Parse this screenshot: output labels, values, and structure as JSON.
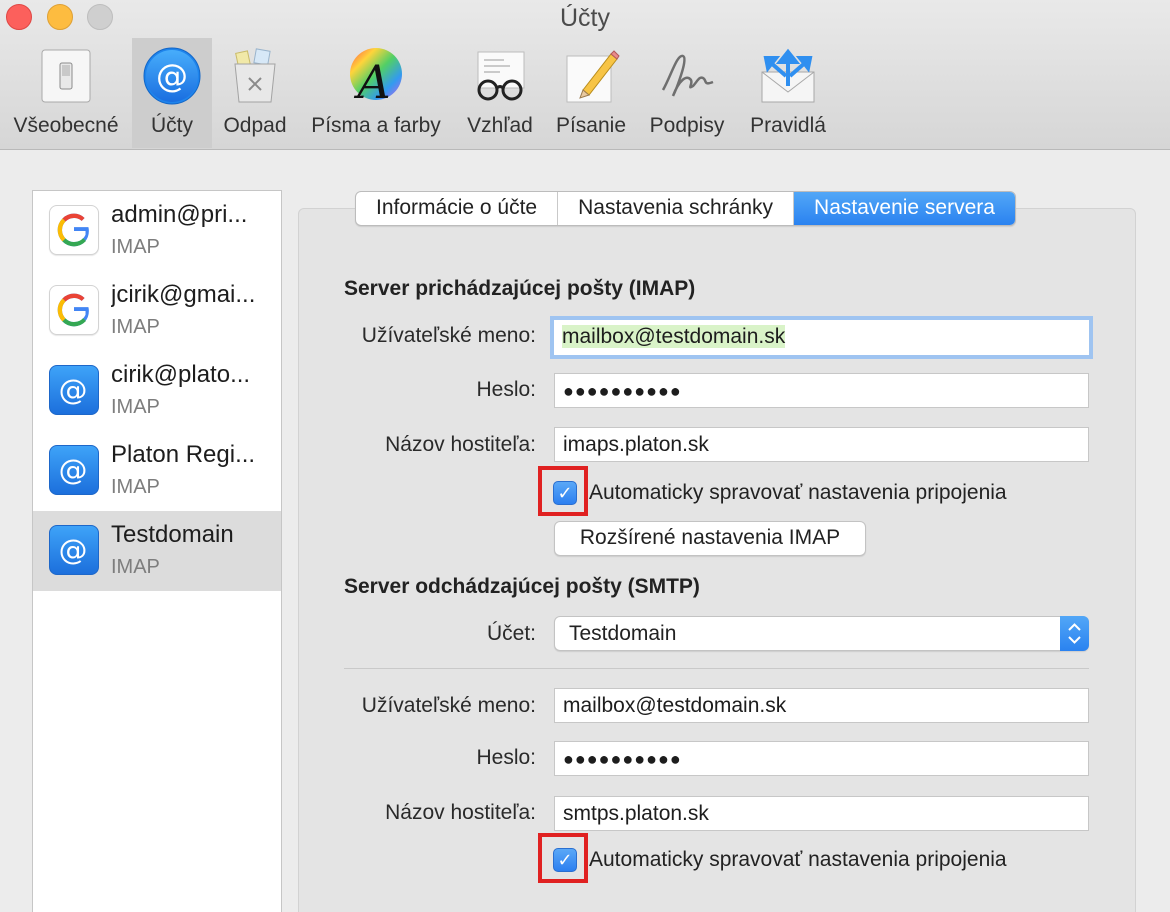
{
  "window": {
    "title": "Účty"
  },
  "toolbar": {
    "items": [
      {
        "label": "Všeobecné",
        "icon": "switch-icon"
      },
      {
        "label": "Účty",
        "icon": "at-icon"
      },
      {
        "label": "Odpad",
        "icon": "trash-icon"
      },
      {
        "label": "Písma a farby",
        "icon": "color-font-icon"
      },
      {
        "label": "Vzhľad",
        "icon": "glasses-icon"
      },
      {
        "label": "Písanie",
        "icon": "pencil-icon"
      },
      {
        "label": "Podpisy",
        "icon": "signature-icon"
      },
      {
        "label": "Pravidlá",
        "icon": "rules-envelope-icon"
      }
    ],
    "active": "Účty"
  },
  "sidebar": {
    "accounts": [
      {
        "name": "admin@pri...",
        "type": "IMAP",
        "icon": "google-icon"
      },
      {
        "name": "jcirik@gmai...",
        "type": "IMAP",
        "icon": "google-icon"
      },
      {
        "name": "cirik@plato...",
        "type": "IMAP",
        "icon": "at-icon"
      },
      {
        "name": "Platon Regi...",
        "type": "IMAP",
        "icon": "at-icon"
      },
      {
        "name": "Testdomain",
        "type": "IMAP",
        "icon": "at-icon"
      }
    ],
    "selected": "Testdomain"
  },
  "tabs": [
    {
      "label": "Informácie o účte"
    },
    {
      "label": "Nastavenia schránky"
    },
    {
      "label": "Nastavenie servera"
    }
  ],
  "active_tab": "Nastavenie servera",
  "incoming": {
    "title": "Server prichádzajúcej pošty (IMAP)",
    "username_label": "Užívateľské meno:",
    "username": "mailbox@testdomain.sk",
    "password_label": "Heslo:",
    "password": "●●●●●●●●●●",
    "host_label": "Názov hostiteľa:",
    "host": "imaps.platon.sk",
    "auto_label": "Automaticky spravovať nastavenia pripojenia",
    "auto_checked": true,
    "advanced_button": "Rozšírené nastavenia IMAP"
  },
  "outgoing": {
    "title": "Server odchádzajúcej pošty (SMTP)",
    "account_label": "Účet:",
    "account": "Testdomain",
    "username_label": "Užívateľské meno:",
    "username": "mailbox@testdomain.sk",
    "password_label": "Heslo:",
    "password": "●●●●●●●●●●",
    "host_label": "Názov hostiteľa:",
    "host": "smtps.platon.sk",
    "auto_label": "Automaticky spravovať nastavenia pripojenia",
    "auto_checked": true
  },
  "colors": {
    "accent": "#2a82f0",
    "highlight_red": "#e02121",
    "autofill": "#d9f3c8"
  }
}
